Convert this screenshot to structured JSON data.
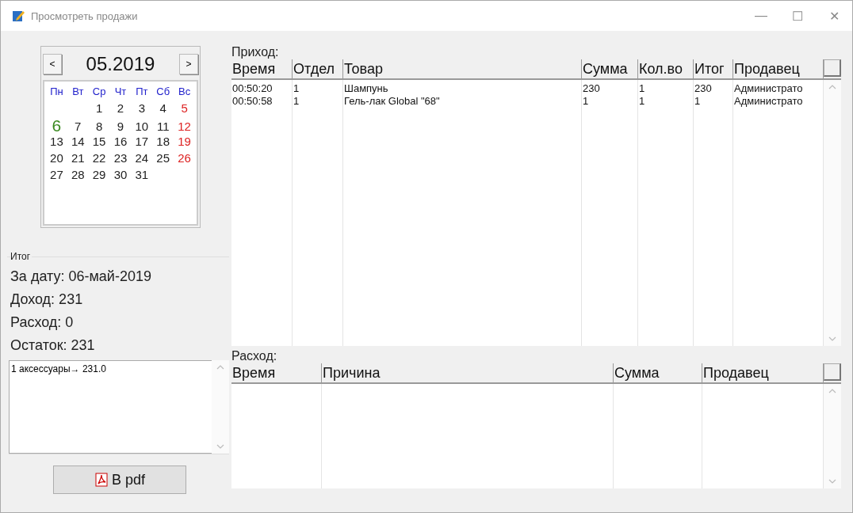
{
  "window": {
    "title": "Просмотреть продажи",
    "controls": [
      "—",
      "☐",
      "✕"
    ]
  },
  "calendar": {
    "prev": "<",
    "month": "05.2019",
    "next": ">",
    "weekdays": [
      "Пн",
      "Вт",
      "Ср",
      "Чт",
      "Пт",
      "Сб",
      "Вс"
    ],
    "weeks": [
      {
        "days": [
          {
            "label": "1",
            "selected": false,
            "holiday": false
          },
          {
            "label": "2",
            "selected": false,
            "holiday": false
          },
          {
            "label": "3",
            "selected": false,
            "holiday": false
          },
          {
            "label": "4",
            "selected": false,
            "holiday": false
          },
          {
            "label": "5",
            "selected": false,
            "holiday": true
          }
        ]
      },
      {
        "days": [
          {
            "label": "6",
            "selected": true,
            "holiday": false
          },
          {
            "label": "7",
            "selected": false,
            "holiday": false
          },
          {
            "label": "8",
            "selected": false,
            "holiday": false
          },
          {
            "label": "9",
            "selected": false,
            "holiday": false
          },
          {
            "label": "10",
            "selected": false,
            "holiday": false
          },
          {
            "label": "11",
            "selected": false,
            "holiday": false
          },
          {
            "label": "12",
            "selected": false,
            "holiday": true
          }
        ]
      },
      {
        "days": [
          {
            "label": "13",
            "selected": false,
            "holiday": false
          },
          {
            "label": "14",
            "selected": false,
            "holiday": false
          },
          {
            "label": "15",
            "selected": false,
            "holiday": false
          },
          {
            "label": "16",
            "selected": false,
            "holiday": false
          },
          {
            "label": "17",
            "selected": false,
            "holiday": false
          },
          {
            "label": "18",
            "selected": false,
            "holiday": false
          },
          {
            "label": "19",
            "selected": false,
            "holiday": true
          }
        ]
      },
      {
        "days": [
          {
            "label": "20",
            "selected": false,
            "holiday": false
          },
          {
            "label": "21",
            "selected": false,
            "holiday": false
          },
          {
            "label": "22",
            "selected": false,
            "holiday": false
          },
          {
            "label": "23",
            "selected": false,
            "holiday": false
          },
          {
            "label": "24",
            "selected": false,
            "holiday": false
          },
          {
            "label": "25",
            "selected": false,
            "holiday": false
          },
          {
            "label": "26",
            "selected": false,
            "holiday": true
          }
        ]
      },
      {
        "days": [
          {
            "label": "27",
            "selected": false,
            "holiday": false
          },
          {
            "label": "28",
            "selected": false,
            "holiday": false
          },
          {
            "label": "29",
            "selected": false,
            "holiday": false
          },
          {
            "label": "30",
            "selected": false,
            "holiday": false
          },
          {
            "label": "31",
            "selected": false,
            "holiday": false
          }
        ]
      }
    ]
  },
  "summary": {
    "title": "Итог",
    "lines": [
      "За дату: 06-май-2019",
      "Доход: 231",
      "Расход: 0",
      "Остаток: 231"
    ],
    "list": [
      "1 аксессуары→ 231.0"
    ]
  },
  "export_button": {
    "label": "В pdf"
  },
  "income": {
    "title": "Приход:",
    "columns": [
      "Время",
      "Отдел",
      "Товар",
      "Сумма",
      "Кол.во",
      "Итог",
      "Продавец"
    ],
    "rows": [
      [
        "00:50:20",
        "1",
        "Шампунь",
        "230",
        "1",
        "230",
        "Администрато"
      ],
      [
        "00:50:58",
        "1",
        "Гель-лак Global \"68\"",
        "1",
        "1",
        "1",
        "Администрато"
      ]
    ]
  },
  "expense": {
    "title": "Расход:",
    "columns": [
      "Время",
      "Причина",
      "Сумма",
      "Продавец"
    ]
  }
}
